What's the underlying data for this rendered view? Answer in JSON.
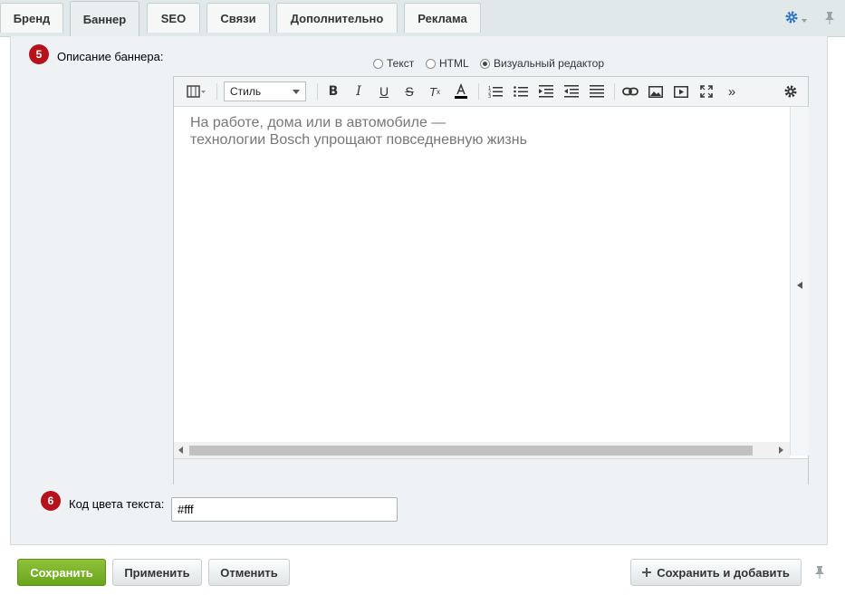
{
  "tabs": [
    "Бренд",
    "Баннер",
    "SEO",
    "Связи",
    "Дополнительно",
    "Реклама"
  ],
  "active_tab": "Баннер",
  "colors": {
    "badge": "#b5121b",
    "settings_icon": "#2a74c4",
    "primary_button": "#7db42b"
  },
  "fields": {
    "description": {
      "number": "5",
      "label": "Описание баннера:",
      "modes": [
        "Текст",
        "HTML",
        "Визуальный редактор"
      ],
      "selected_mode": "Визуальный редактор"
    },
    "text_color": {
      "number": "6",
      "label": "Код цвета текста:",
      "value": "#fff"
    }
  },
  "editor": {
    "style_select": "Стиль",
    "toolbar_icons": [
      "layout-icon",
      "bold-icon",
      "italic-icon",
      "underline-icon",
      "strikethrough-icon",
      "remove-format-icon",
      "font-color-icon",
      "ordered-list-icon",
      "unordered-list-icon",
      "indent-icon",
      "outdent-icon",
      "align-icon",
      "link-icon",
      "image-icon",
      "video-icon",
      "fullscreen-icon",
      "more-icon",
      "editor-settings-icon"
    ],
    "content_line1": "На работе, дома или в автомобиле —",
    "content_line2": "технологии Bosch упрощают повседневную жизнь"
  },
  "buttons": {
    "save": "Сохранить",
    "apply": "Применить",
    "cancel": "Отменить",
    "save_add": "Сохранить и добавить"
  }
}
